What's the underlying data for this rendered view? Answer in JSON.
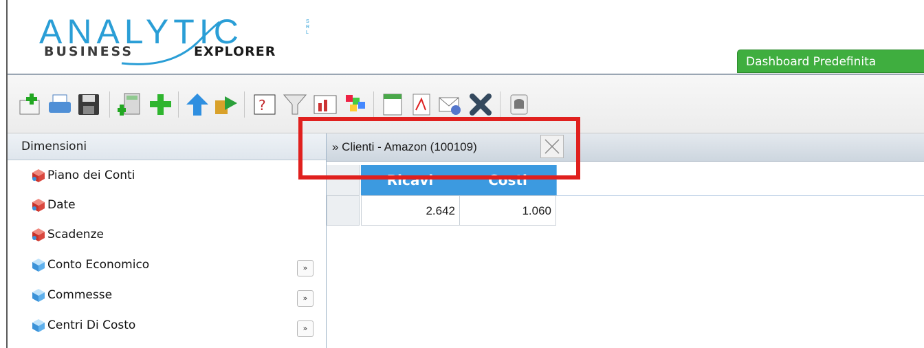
{
  "logo": {
    "main": "ANALYTIC",
    "srl": "SRL",
    "business": "BUSINESS",
    "explorer": "EXPLORER"
  },
  "header": {
    "dashboard_tab": "Dashboard Predefinita"
  },
  "toolbar": {
    "icons": [
      "new-icon",
      "print-icon",
      "save-icon",
      "calculator-add-icon",
      "add-icon",
      "up-arrow-icon",
      "export-icon",
      "help-icon",
      "filter-icon",
      "chart-icon",
      "color-palette-icon",
      "spreadsheet-icon",
      "pdf-icon",
      "email-icon",
      "delete-icon",
      "database-icon"
    ]
  },
  "sidebar": {
    "title": "Dimensioni",
    "items": [
      {
        "label": "Piano dei Conti",
        "icon": "red-cube-icon",
        "expand": ""
      },
      {
        "label": "Date",
        "icon": "red-cube-icon",
        "expand": ""
      },
      {
        "label": "Scadenze",
        "icon": "red-cube-icon",
        "expand": ""
      },
      {
        "label": "Conto Economico",
        "icon": "blue-cube-icon",
        "expand": "»"
      },
      {
        "label": "Commesse",
        "icon": "blue-cube-icon",
        "expand": "»"
      },
      {
        "label": "Centri Di Costo",
        "icon": "blue-cube-icon",
        "expand": "»"
      }
    ]
  },
  "main": {
    "breadcrumb": "» Clienti - Amazon (100109)",
    "columns": [
      "Ricavi",
      "Costi"
    ],
    "rows": [
      [
        "2.642",
        "1.060"
      ]
    ]
  },
  "colors": {
    "accent_blue": "#3c9ae0",
    "tab_green": "#3fae3f",
    "highlight_red": "#e0201e"
  }
}
